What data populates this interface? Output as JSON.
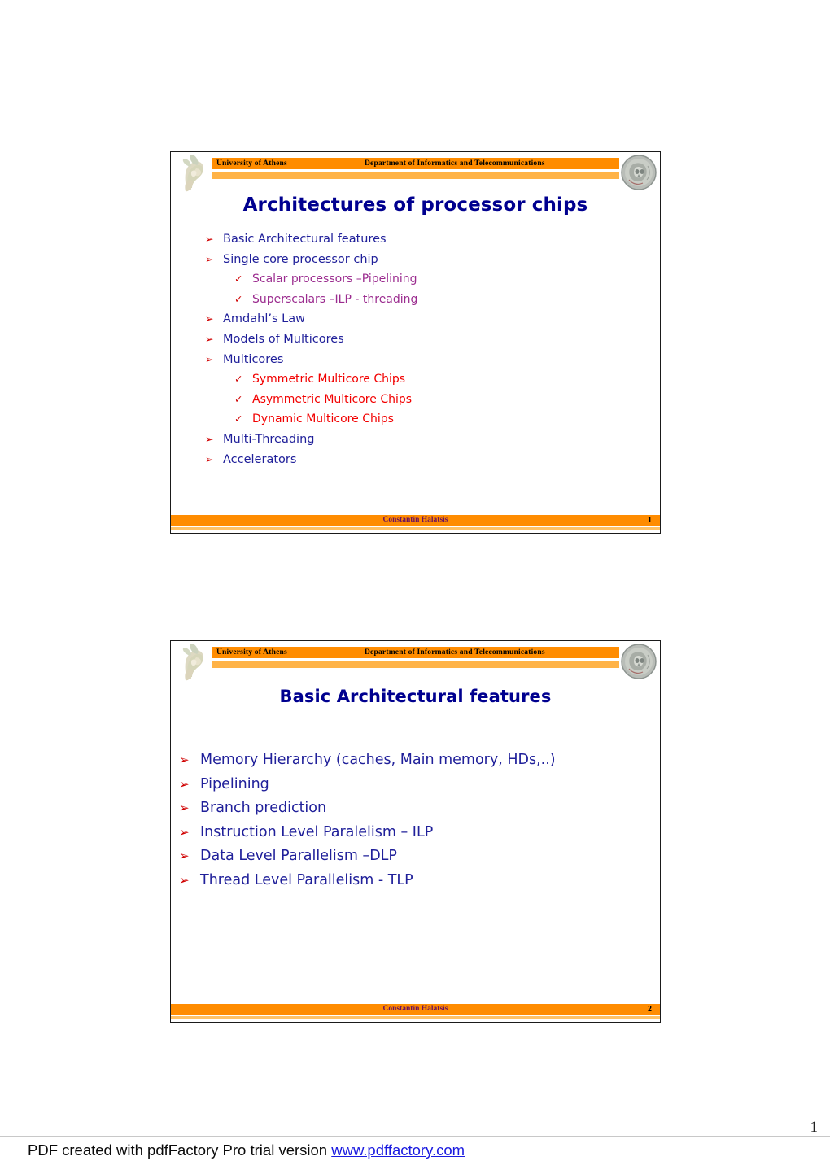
{
  "document": {
    "page_number": "1",
    "footer_text": "PDF created with pdfFactory Pro trial version ",
    "footer_url": "www.pdffactory.com"
  },
  "slides": [
    {
      "header": {
        "university": "University of Athens",
        "department": "Department of Informatics and Telecommunications",
        "left_logo": "athena-statue-icon",
        "right_logo": "greek-coin-icon"
      },
      "title": "Architectures of processor chips",
      "items": [
        {
          "level": 1,
          "marker": "➢",
          "text": "Basic Architectural features",
          "color": "navy"
        },
        {
          "level": 1,
          "marker": "➢",
          "text": "Single core processor chip",
          "color": "navy"
        },
        {
          "level": 2,
          "marker": "✓",
          "text": "Scalar processors –Pipelining",
          "color": "purple"
        },
        {
          "level": 2,
          "marker": "✓",
          "text": "Superscalars –ILP - threading",
          "color": "purple"
        },
        {
          "level": 1,
          "marker": "➢",
          "text": "Amdahl’s Law",
          "color": "navy"
        },
        {
          "level": 1,
          "marker": "➢",
          "text": "Models of Multicores",
          "color": "navy"
        },
        {
          "level": 1,
          "marker": "➢",
          "text": "Multicores",
          "color": "navy"
        },
        {
          "level": 2,
          "marker": "✓",
          "text": "Symmetric Multicore Chips",
          "color": "red"
        },
        {
          "level": 2,
          "marker": "✓",
          "text": "Asymmetric Multicore Chips",
          "color": "red"
        },
        {
          "level": 2,
          "marker": "✓",
          "text": "Dynamic Multicore Chips",
          "color": "red"
        },
        {
          "level": 1,
          "marker": "➢",
          "text": "Multi-Threading",
          "color": "navy"
        },
        {
          "level": 1,
          "marker": "➢",
          "text": "Accelerators",
          "color": "navy"
        }
      ],
      "footer": {
        "author": "Constantin Halatsis",
        "page_number": "1"
      }
    },
    {
      "header": {
        "university": "University of Athens",
        "department": "Department of Informatics and Telecommunications",
        "left_logo": "athena-statue-icon",
        "right_logo": "greek-coin-icon"
      },
      "title": "Basic Architectural features",
      "items": [
        {
          "level": 1,
          "marker": "➢",
          "text": "Memory Hierarchy (caches, Main memory, HDs,..)",
          "color": "navy"
        },
        {
          "level": 1,
          "marker": "➢",
          "text": "Pipelining",
          "color": "navy"
        },
        {
          "level": 1,
          "marker": "➢",
          "text": "Branch prediction",
          "color": "navy"
        },
        {
          "level": 1,
          "marker": "➢",
          "text": "Instruction Level Paralelism – ILP",
          "color": "navy"
        },
        {
          "level": 1,
          "marker": "➢",
          "text": "Data Level Parallelism –DLP",
          "color": "navy"
        },
        {
          "level": 1,
          "marker": "➢",
          "text": "Thread Level Parallelism - TLP",
          "color": "navy"
        }
      ],
      "footer": {
        "author": "Constantin Halatsis",
        "page_number": "2"
      }
    }
  ],
  "colors": {
    "header_orange": "#FF8C00",
    "header_orange_light": "#FFB347",
    "title_navy": "#00008F",
    "bullet_red": "#D00000",
    "text_navy": "#20209A",
    "text_purple": "#9B2C8F",
    "text_red": "#F20000",
    "footer_author": "#6B1060",
    "link_blue": "#1a1ae0"
  }
}
